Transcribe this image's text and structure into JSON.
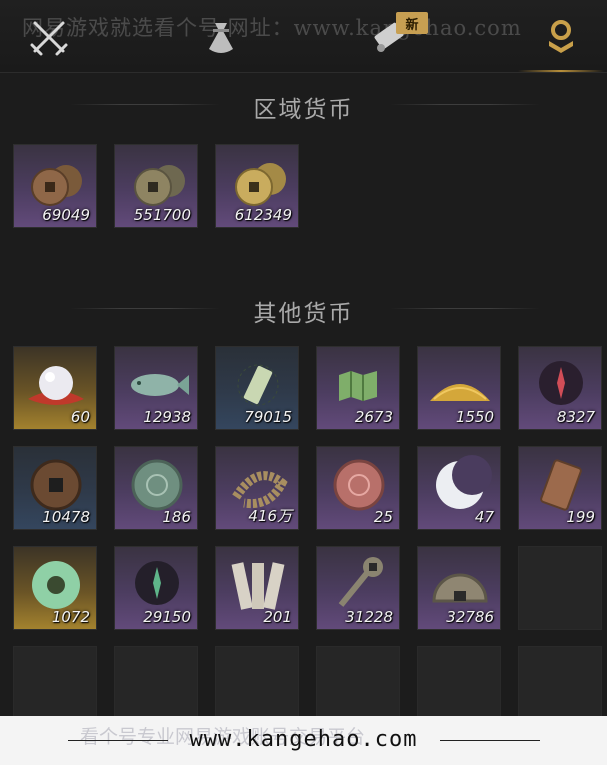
{
  "watermark": {
    "top_text": "网易游戏就选看个号  网址：www.kangehao.com",
    "bottom_text": "看个号专业网易游戏账号交易平台",
    "url": "www.kangehao.com"
  },
  "tabs": [
    {
      "icon": "crossed-swords-icon",
      "active": false
    },
    {
      "icon": "pouch-icon",
      "active": false
    },
    {
      "icon": "scroll-icon",
      "active": false,
      "badge": "新"
    },
    {
      "icon": "currency-icon",
      "active": true
    }
  ],
  "regional": {
    "title": "区域货币",
    "items": [
      {
        "icon": "copper-coins-icon",
        "count": "69049",
        "rarity": "purple"
      },
      {
        "icon": "bronze-coins-icon",
        "count": "551700",
        "rarity": "purple"
      },
      {
        "icon": "gold-coins-icon",
        "count": "612349",
        "rarity": "purple"
      }
    ]
  },
  "other": {
    "title": "其他货币",
    "items": [
      {
        "icon": "pearl-icon",
        "count": "60",
        "rarity": "gold"
      },
      {
        "icon": "jade-fish-icon",
        "count": "12938",
        "rarity": "purple"
      },
      {
        "icon": "green-token-icon",
        "count": "79015",
        "rarity": "blue"
      },
      {
        "icon": "green-map-icon",
        "count": "2673",
        "rarity": "purple"
      },
      {
        "icon": "grain-pile-icon",
        "count": "1550",
        "rarity": "purple"
      },
      {
        "icon": "red-emblem-icon",
        "count": "8327",
        "rarity": "purple"
      },
      {
        "icon": "square-hole-coin-icon",
        "count": "10478",
        "rarity": "blue"
      },
      {
        "icon": "jade-medallion-icon",
        "count": "186",
        "rarity": "purple"
      },
      {
        "icon": "coin-string-icon",
        "count": "416万",
        "rarity": "purple"
      },
      {
        "icon": "red-medallion-icon",
        "count": "25",
        "rarity": "purple"
      },
      {
        "icon": "crescent-moon-icon",
        "count": "47",
        "rarity": "purple"
      },
      {
        "icon": "bronze-tablet-icon",
        "count": "199",
        "rarity": "purple"
      },
      {
        "icon": "jade-ring-icon",
        "count": "1072",
        "rarity": "gold"
      },
      {
        "icon": "green-emblem-icon",
        "count": "29150",
        "rarity": "purple"
      },
      {
        "icon": "talisman-slips-icon",
        "count": "201",
        "rarity": "purple"
      },
      {
        "icon": "coin-sword-icon",
        "count": "31228",
        "rarity": "purple"
      },
      {
        "icon": "half-coin-icon",
        "count": "32786",
        "rarity": "purple"
      }
    ]
  }
}
